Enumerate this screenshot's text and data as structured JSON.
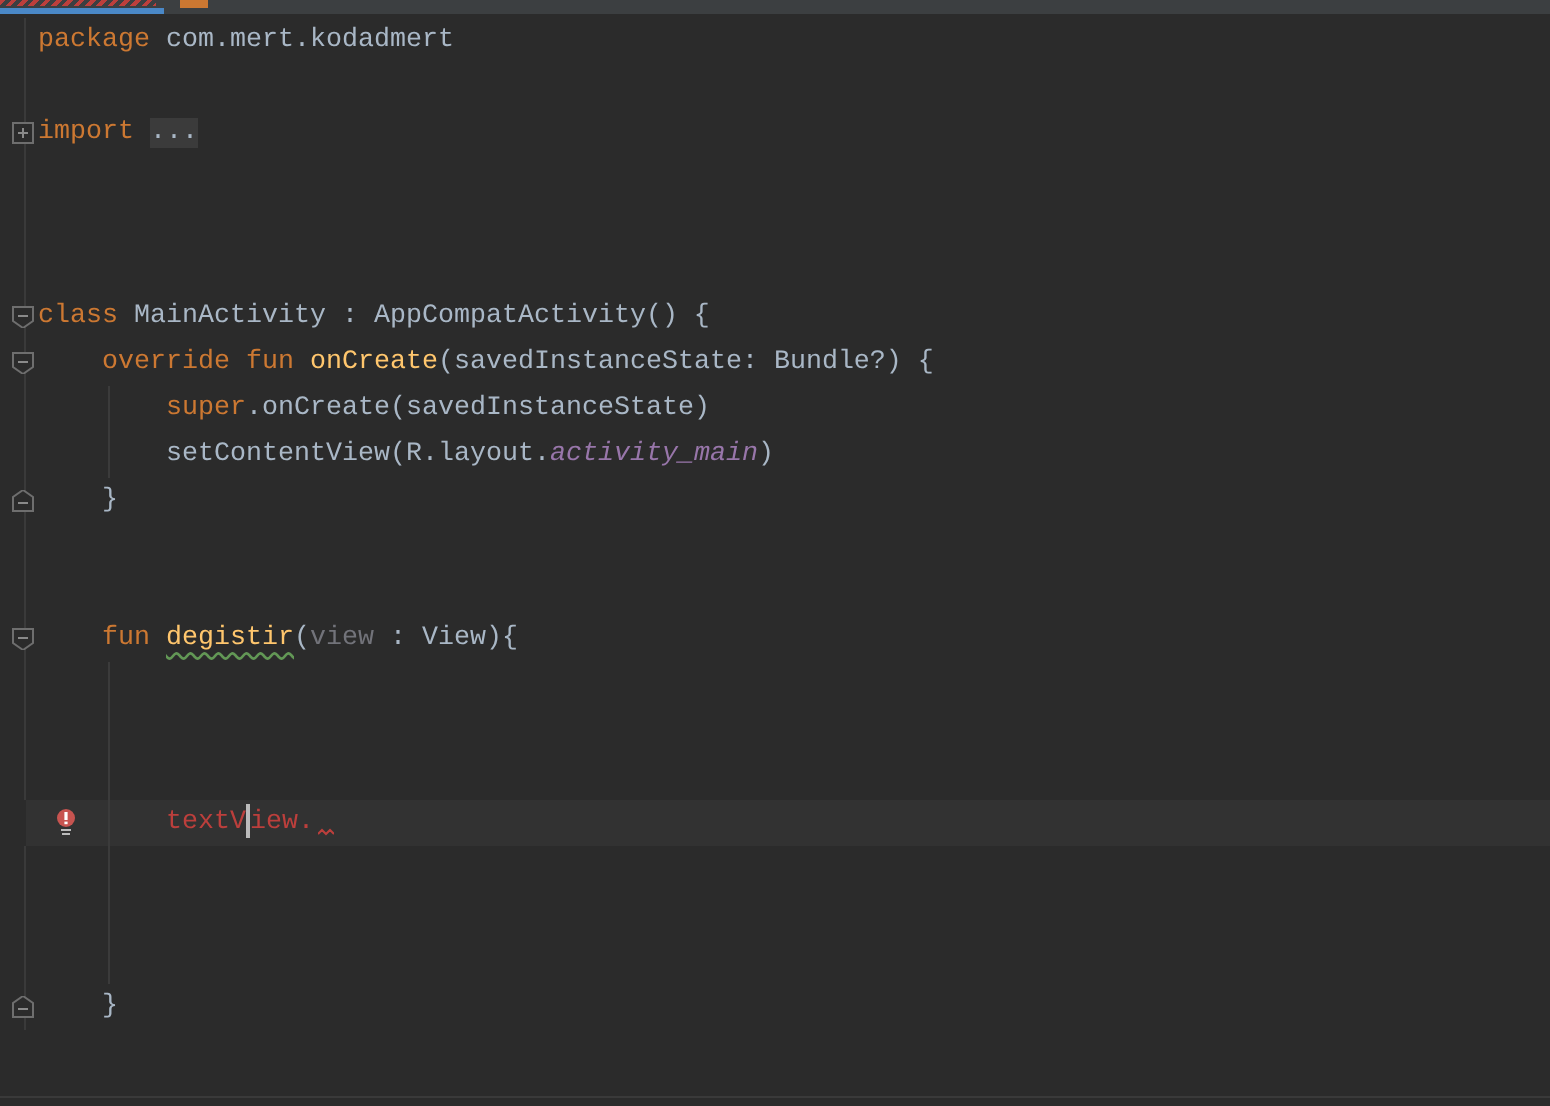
{
  "tabs": [
    {
      "selected": true,
      "has_errors": true
    },
    {
      "selected": false,
      "has_errors": false
    }
  ],
  "lines": [
    {
      "current": false,
      "guide": false,
      "error": false,
      "tokens": [
        {
          "text": "package ",
          "kind": "keyword"
        },
        {
          "text": "com.mert.kodadmert",
          "kind": "plain"
        }
      ]
    },
    {
      "current": false,
      "guide": false,
      "error": false
    },
    {
      "current": false,
      "guide": false,
      "error": false,
      "marker": {
        "kind": "expand"
      },
      "tokens": [
        {
          "text": "import ",
          "kind": "keyword"
        },
        {
          "text": "...",
          "kind": "folded"
        }
      ]
    },
    {
      "current": false,
      "guide": false,
      "error": false
    },
    {
      "current": false,
      "guide": false,
      "error": false
    },
    {
      "current": false,
      "guide": false,
      "error": false
    },
    {
      "current": false,
      "guide": false,
      "error": false,
      "marker": {
        "kind": "start"
      },
      "tokens": [
        {
          "text": "class ",
          "kind": "keyword"
        },
        {
          "text": "MainActivity : AppCompatActivity() {",
          "kind": "plain"
        }
      ]
    },
    {
      "current": false,
      "guide": false,
      "error": false,
      "marker": {
        "kind": "start"
      },
      "tokens": [
        {
          "text": "    override fun ",
          "kind": "keyword"
        },
        {
          "text": "onCreate",
          "kind": "declaration"
        },
        {
          "text": "(savedInstanceState: Bundle?) {",
          "kind": "plain"
        }
      ]
    },
    {
      "current": false,
      "guide": true,
      "error": false,
      "tokens": [
        {
          "text": "        super",
          "kind": "keyword"
        },
        {
          "text": ".onCreate(savedInstanceState)",
          "kind": "plain"
        }
      ]
    },
    {
      "current": false,
      "guide": true,
      "error": false,
      "tokens": [
        {
          "text": "        setContentView(R.layout.",
          "kind": "plain"
        },
        {
          "text": "activity_main",
          "kind": "property"
        },
        {
          "text": ")",
          "kind": "plain"
        }
      ]
    },
    {
      "current": false,
      "guide": false,
      "error": false,
      "marker": {
        "kind": "end"
      },
      "tokens": [
        {
          "text": "    }",
          "kind": "plain"
        }
      ]
    },
    {
      "current": false,
      "guide": false,
      "error": false
    },
    {
      "current": false,
      "guide": false,
      "error": false
    },
    {
      "current": false,
      "guide": false,
      "error": false,
      "marker": {
        "kind": "start"
      },
      "tokens": [
        {
          "text": "    fun ",
          "kind": "keyword"
        },
        {
          "text": "degistir",
          "kind": "declaration",
          "warning": true
        },
        {
          "text": "(",
          "kind": "plain"
        },
        {
          "text": "view",
          "kind": "unused"
        },
        {
          "text": " : View){",
          "kind": "plain"
        }
      ]
    },
    {
      "current": false,
      "guide": true,
      "error": false
    },
    {
      "current": false,
      "guide": true,
      "error": false
    },
    {
      "current": false,
      "guide": true,
      "error": false
    },
    {
      "current": true,
      "guide": true,
      "error": true,
      "tokens": [
        {
          "text": "        textV",
          "kind": "unresolved",
          "caret": true
        },
        {
          "text": "iew.",
          "kind": "unresolved"
        }
      ]
    },
    {
      "current": false,
      "guide": true,
      "error": false
    },
    {
      "current": false,
      "guide": true,
      "error": false
    },
    {
      "current": false,
      "guide": true,
      "error": false
    },
    {
      "current": false,
      "guide": false,
      "error": false,
      "marker": {
        "kind": "end"
      },
      "tokens": [
        {
          "text": "    }",
          "kind": "plain"
        }
      ]
    }
  ]
}
